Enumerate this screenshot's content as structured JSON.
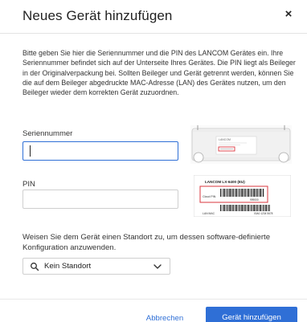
{
  "dialog": {
    "title": "Neues Gerät hinzufügen",
    "close_symbol": "×",
    "intro": "Bitte geben Sie hier die Seriennummer und die PIN des LANCOM Gerätes ein. Ihre Seriennummer befindet sich auf der Unterseite Ihres Gerätes. Die PIN liegt als Beileger in der Originalverpackung bei. Sollten Beileger und Gerät getrennt werden, können Sie die auf dem Beileger abgedruckte MAC-Adresse (LAN) des Gerätes nutzen, um den Beileger wieder dem korrekten Gerät zuzuordnen."
  },
  "form": {
    "serial_label": "Seriennummer",
    "serial_value": "",
    "pin_label": "PIN",
    "pin_value": "",
    "standort_text": "Weisen Sie dem Gerät einen Standort zu, um dessen software-definierte Konfiguration anzuwenden.",
    "standort_select": "Kein Standort"
  },
  "images": {
    "device_label_top": "LANCOM",
    "card_title": "LANCOM LX-6400 (EU)",
    "card_cloud_pin": "Cloud PIN",
    "card_pin_value": "999000",
    "card_lan_mac": "LAN MAC",
    "card_mac_value": "00A0 1234 5678"
  },
  "footer": {
    "cancel_label": "Abbrechen",
    "add_label": "Gerät hinzufügen"
  },
  "colors": {
    "primary": "#2f6fd6",
    "highlight_box": "#d9363e"
  },
  "icons": {
    "close": "close-icon",
    "search": "search-icon",
    "chevron": "chevron-down-icon"
  }
}
